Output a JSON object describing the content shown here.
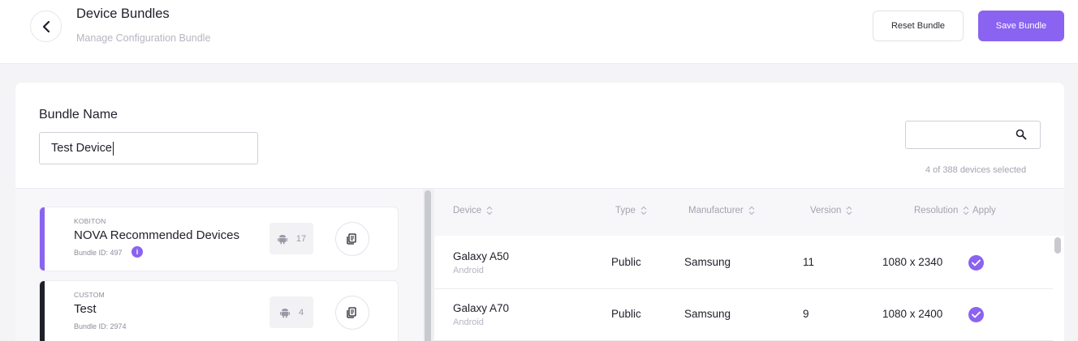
{
  "header": {
    "title": "Device Bundles",
    "subtitle": "Manage Configuration Bundle",
    "reset_label": "Reset Bundle",
    "save_label": "Save Bundle",
    "icons": {
      "back": "chevron-left-icon"
    }
  },
  "form": {
    "bundle_name_label": "Bundle Name",
    "bundle_name_value": "Test Device"
  },
  "search": {
    "value": "",
    "icon": "search-icon",
    "selected_text": "4 of 388 devices selected"
  },
  "bundles": [
    {
      "kind": "KOBITON",
      "name": "NOVA Recommended Devices",
      "bundle_id": "Bundle ID: 497",
      "count": "17",
      "accent": "#8a63f0",
      "has_info": true
    },
    {
      "kind": "CUSTOM",
      "name": "Test",
      "bundle_id": "Bundle ID: 2974",
      "count": "4",
      "accent": "#1f1f2b",
      "has_info": false
    }
  ],
  "table": {
    "columns": [
      "Device",
      "Type",
      "Manufacturer",
      "Version",
      "Resolution",
      "Apply"
    ],
    "rows": [
      {
        "device": "Galaxy A50",
        "platform": "Android",
        "type": "Public",
        "manufacturer": "Samsung",
        "version": "11",
        "resolution": "1080 x 2340",
        "applied": true
      },
      {
        "device": "Galaxy A70",
        "platform": "Android",
        "type": "Public",
        "manufacturer": "Samsung",
        "version": "9",
        "resolution": "1080 x 2400",
        "applied": true
      }
    ]
  },
  "colors": {
    "accent": "#8a63f0",
    "custom_accent": "#1f1f2b"
  }
}
